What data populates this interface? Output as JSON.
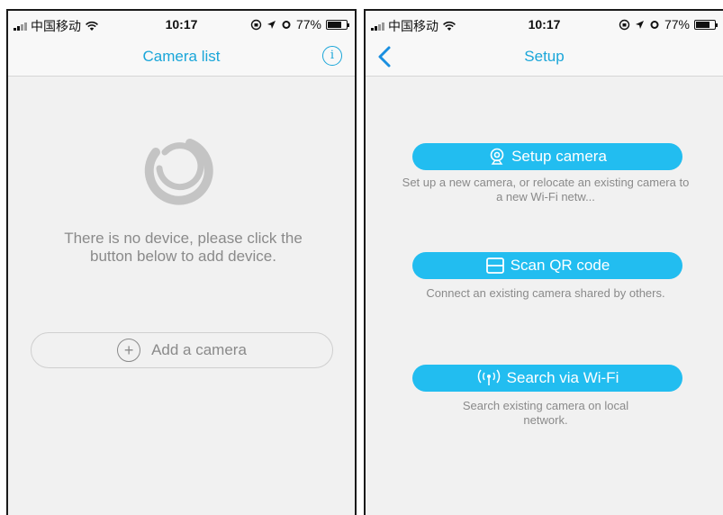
{
  "status_bar": {
    "carrier": "中国移动",
    "time": "10:17",
    "battery": "77%",
    "battery_level": 0.77
  },
  "camera_list_screen": {
    "title": "Camera list",
    "info_glyph": "i",
    "empty_message": "There is no device, please click the button below to add device.",
    "add_button_label": "Add a camera",
    "add_glyph": "+"
  },
  "setup_screen": {
    "title": "Setup",
    "options": [
      {
        "label": "Setup camera",
        "icon": "webcam-icon",
        "description": "Set up a new camera, or relocate an existing camera to a new Wi-Fi netw..."
      },
      {
        "label": "Scan QR code",
        "icon": "qr-scan-icon",
        "description": "Connect an existing camera shared by others."
      },
      {
        "label": "Search via Wi-Fi",
        "icon": "wifi-broadcast-icon",
        "description": "Search existing camera on local network."
      }
    ]
  },
  "colors": {
    "accent": "#1aa6d9",
    "button": "#22bdf0",
    "muted_text": "#8a8a8a",
    "background": "#f1f1f1"
  }
}
